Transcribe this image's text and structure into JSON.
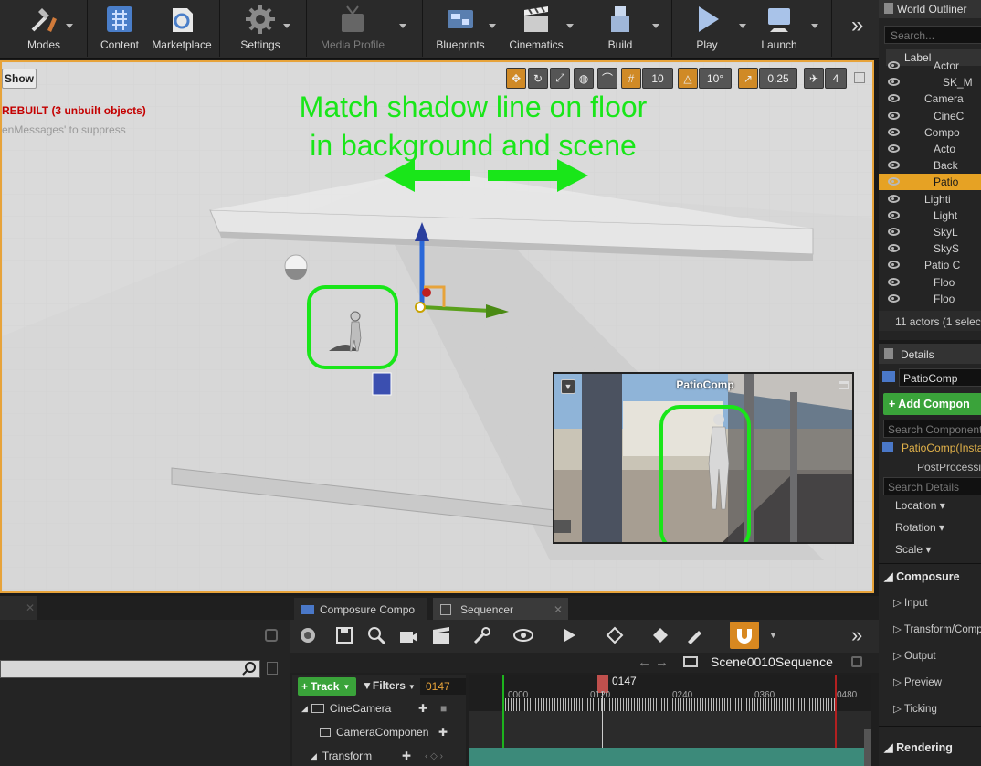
{
  "toolbar": {
    "items": [
      {
        "label": "Modes",
        "icon": "modes-icon"
      },
      {
        "label": "Content",
        "icon": "content-icon"
      },
      {
        "label": "Marketplace",
        "icon": "marketplace-icon"
      },
      {
        "label": "Settings",
        "icon": "settings-icon"
      },
      {
        "label": "Media Profile",
        "icon": "media-profile-icon"
      },
      {
        "label": "Blueprints",
        "icon": "blueprints-icon"
      },
      {
        "label": "Cinematics",
        "icon": "cinematics-icon"
      },
      {
        "label": "Build",
        "icon": "build-icon"
      },
      {
        "label": "Play",
        "icon": "play-icon"
      },
      {
        "label": "Launch",
        "icon": "launch-icon"
      }
    ],
    "overflow": "»"
  },
  "viewport": {
    "show_label": "Show",
    "warning": "REBUILT (3 unbuilt objects)",
    "warning_sub": "enMessages' to suppress",
    "annotation_line1": "Match shadow line on floor",
    "annotation_line2": "in background and scene",
    "grid_snap": "10",
    "rotation_snap": "10°",
    "scale_snap": "0.25",
    "camera_speed": "4",
    "pip_title": "PatioComp"
  },
  "outliner": {
    "title": "World Outliner",
    "search_placeholder": "Search...",
    "column_label": "Label",
    "rows": [
      {
        "label": "Actor",
        "indent": 3
      },
      {
        "label": "SK_M",
        "indent": 4
      },
      {
        "label": "Camera",
        "indent": 2
      },
      {
        "label": "CineC",
        "indent": 3
      },
      {
        "label": "Compo",
        "indent": 2
      },
      {
        "label": "Acto",
        "indent": 3
      },
      {
        "label": "Back",
        "indent": 3
      },
      {
        "label": "Patio",
        "indent": 3
      },
      {
        "label": "Lighti",
        "indent": 2
      },
      {
        "label": "Light",
        "indent": 3
      },
      {
        "label": "SkyL",
        "indent": 3
      },
      {
        "label": "SkyS",
        "indent": 3
      },
      {
        "label": "Patio C",
        "indent": 2
      },
      {
        "label": "Floo",
        "indent": 3
      },
      {
        "label": "Floo",
        "indent": 3
      }
    ],
    "selected_index": 7,
    "status": "11 actors (1 selec"
  },
  "details": {
    "title": "Details",
    "object_name": "PatioComp",
    "add_component_label": "+ Add Compon",
    "search_components_placeholder": "Search Component",
    "instance_label": "PatioComp(Insta",
    "postprocess_label": "PostProcessi",
    "search_details_placeholder": "Search Details",
    "transform_props": [
      "Location",
      "Rotation",
      "Scale"
    ],
    "category": "Composure",
    "sub_items": [
      "Input",
      "Transform/Comp",
      "Output",
      "Preview",
      "Ticking"
    ],
    "rendering_category": "Rendering"
  },
  "bottom": {
    "tab_composure": "Composure Compo",
    "tab_sequencer": "Sequencer",
    "sequence_name": "Scene0010Sequence",
    "track_button": "Track",
    "filters_button": "Filters",
    "search_value": "0147",
    "current_frame": "0147",
    "ruler_ticks": [
      "0000",
      "0120",
      "0240",
      "0360",
      "0480"
    ],
    "tracks": [
      {
        "label": "CineCamera"
      },
      {
        "label": "CameraComponen"
      },
      {
        "label": "Transform"
      }
    ]
  },
  "colors": {
    "accent_orange": "#e7a33a",
    "annotation_green": "#19e619",
    "selection": "#e6a224",
    "add_green": "#3aa33a"
  }
}
